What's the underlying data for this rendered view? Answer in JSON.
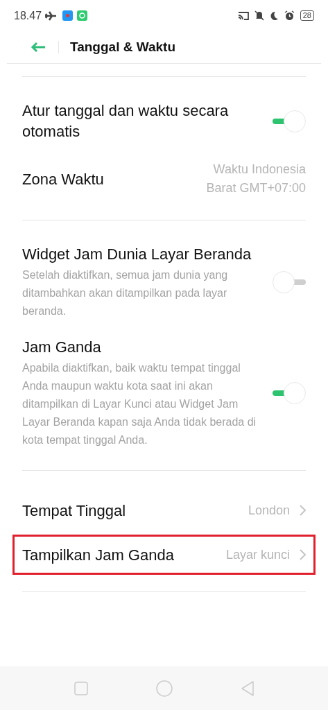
{
  "status_bar": {
    "time": "18.47",
    "battery": "28"
  },
  "header": {
    "title": "Tanggal & Waktu"
  },
  "sections": [
    {
      "rows": [
        {
          "kind": "toggle",
          "title": "Atur tanggal dan waktu secara otomatis",
          "on": true
        },
        {
          "kind": "value",
          "title": "Zona Waktu",
          "value": "Waktu Indonesia Barat GMT+07:00"
        }
      ]
    },
    {
      "rows": [
        {
          "kind": "toggle",
          "title": "Widget Jam Dunia Layar Beranda",
          "description": "Setelah diaktifkan, semua jam dunia yang ditambahkan akan ditampilkan pada layar beranda.",
          "on": false
        },
        {
          "kind": "toggle",
          "title": "Jam Ganda",
          "description": "Apabila diaktifkan, baik waktu tempat tinggal Anda maupun waktu kota saat ini akan ditampilkan di Layar Kunci atau Widget Jam Layar Beranda kapan saja Anda tidak berada di kota tempat tinggal Anda.",
          "on": true
        }
      ]
    },
    {
      "rows": [
        {
          "kind": "link",
          "title": "Tempat Tinggal",
          "value": "London",
          "highlighted": false
        },
        {
          "kind": "link",
          "title": "Tampilkan Jam Ganda",
          "value": "Layar kunci",
          "highlighted": true
        }
      ]
    }
  ]
}
